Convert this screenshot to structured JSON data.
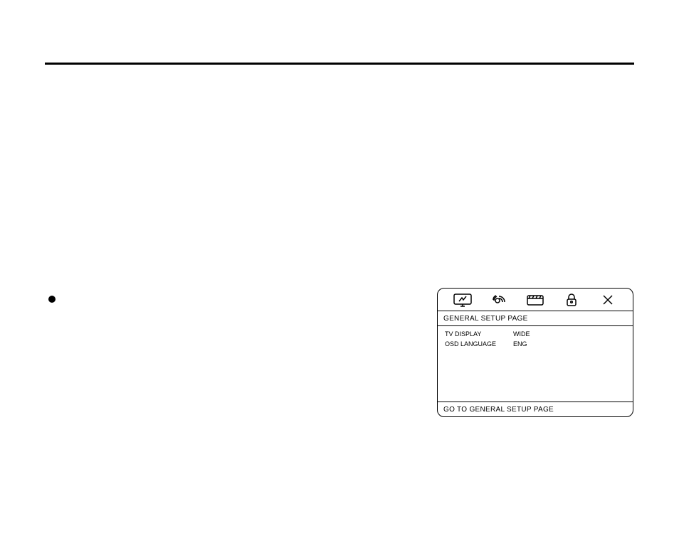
{
  "osd": {
    "title": "GENERAL SETUP PAGE",
    "rows": [
      {
        "label": "TV DISPLAY",
        "value": "WIDE"
      },
      {
        "label": "OSD LANGUAGE",
        "value": "ENG"
      }
    ],
    "footer": "GO TO GENERAL SETUP PAGE",
    "tabs": [
      {
        "icon": "monitor-icon"
      },
      {
        "icon": "audio-icon"
      },
      {
        "icon": "video-icon"
      },
      {
        "icon": "lock-icon"
      },
      {
        "icon": "close-icon"
      }
    ]
  }
}
